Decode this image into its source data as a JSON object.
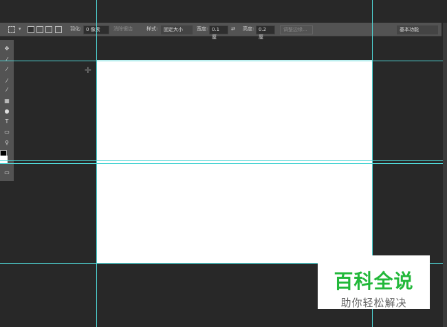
{
  "options_bar": {
    "feather_label": "羽化:",
    "feather_value": "0 像素",
    "antialias_label": "消除锯齿",
    "style_label": "样式:",
    "style_value": "固定大小",
    "width_label": "宽度:",
    "width_value": "0.1 厘",
    "height_label": "高度:",
    "height_value": "0.2 厘",
    "refine_edge": "调整边缘...",
    "workspace": "基本功能"
  },
  "tools": [
    "move",
    "quick-select",
    "eyedropper",
    "brush",
    "history-brush",
    "gradient",
    "dodge",
    "type",
    "rectangle",
    "zoom",
    "swap-colors",
    "foreground-background",
    "screen-mode"
  ],
  "guide_color": "#4fd5d5",
  "watermark": {
    "title": "百科全说",
    "subtitle": "助你轻松解决"
  }
}
